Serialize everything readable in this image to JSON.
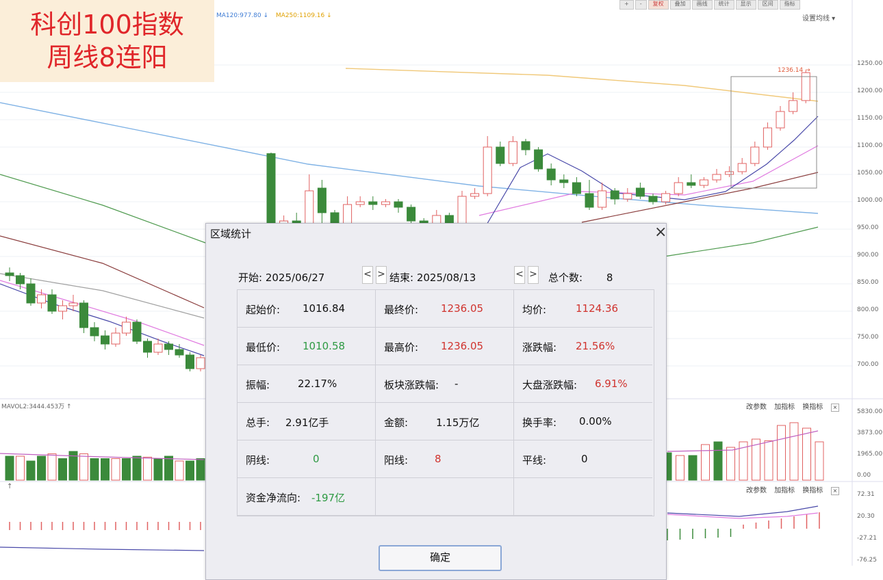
{
  "badge": {
    "line1": "科创100指数",
    "line2": "周线8连阳"
  },
  "toolbar": {
    "btn1": "+",
    "btn2": "-",
    "btn3": "复权",
    "btn4": "叠加",
    "btn5": "画线",
    "btn6": "统计",
    "btn7": "显示",
    "btn8": "区间",
    "btn9": "指标"
  },
  "ma_legend": {
    "ma120": "MA120:977.80 ↓",
    "ma250": "MA250:1109.16 ↓"
  },
  "settings_label": "设置均线 ▾",
  "price_axis": [
    "1250.00",
    "1200.00",
    "1150.00",
    "1100.00",
    "1050.00",
    "1000.00",
    "950.00",
    "900.00",
    "850.00",
    "800.00",
    "750.00",
    "700.00"
  ],
  "peak_label": "1236.14 →",
  "volume_label": "MAVOL2:3444.453万 ↑",
  "volume_axis": [
    "5830.00",
    "3873.00",
    "1965.00",
    "0.00"
  ],
  "macd_axis": [
    "72.31",
    "20.30",
    "-27.21",
    "-76.25"
  ],
  "indicator_buttons": {
    "change": "改参数",
    "add": "加指标",
    "switch": "换指标",
    "close": "×"
  },
  "second_arrow": "↑",
  "dialog": {
    "title": "区域统计",
    "close": "×",
    "start_label": "开始:",
    "start_value": "2025/06/27",
    "end_label": "结束:",
    "end_value": "2025/08/13",
    "count_label": "总个数:",
    "count_value": "8",
    "prev": "<",
    "next": ">",
    "cells": [
      {
        "label": "起始价:",
        "value": "1016.84",
        "color": "black"
      },
      {
        "label": "最终价:",
        "value": "1236.05",
        "color": "red"
      },
      {
        "label": "均价:",
        "value": "1124.36",
        "color": "red"
      },
      {
        "label": "最低价:",
        "value": "1010.58",
        "color": "green"
      },
      {
        "label": "最高价:",
        "value": "1236.05",
        "color": "red"
      },
      {
        "label": "涨跌幅:",
        "value": "21.56%",
        "color": "red"
      },
      {
        "label": "振幅:",
        "value": "22.17%",
        "color": "black"
      },
      {
        "label": "板块涨跌幅:",
        "value": "-",
        "color": "black"
      },
      {
        "label": "大盘涨跌幅:",
        "value": "6.91%",
        "color": "red"
      },
      {
        "label": "总手:",
        "value": "2.91亿手",
        "color": "black"
      },
      {
        "label": "金额:",
        "value": "1.15万亿",
        "color": "black"
      },
      {
        "label": "换手率:",
        "value": "0.00%",
        "color": "black"
      },
      {
        "label": "阴线:",
        "value": "0",
        "color": "green"
      },
      {
        "label": "阳线:",
        "value": "8",
        "color": "red"
      },
      {
        "label": "平线:",
        "value": "0",
        "color": "black"
      },
      {
        "label": "资金净流向:",
        "value": "-197亿",
        "color": "green"
      },
      {
        "label": "",
        "value": "",
        "color": "black"
      },
      {
        "label": "",
        "value": "",
        "color": "black"
      }
    ],
    "ok_label": "确定"
  },
  "chart_data": {
    "type": "candlestick",
    "ylim": [
      680,
      1270
    ],
    "up_color": "#e06060",
    "down_color": "#3b8a3b",
    "candles": [
      [
        870,
        865,
        880,
        855
      ],
      [
        865,
        850,
        870,
        840
      ],
      [
        850,
        815,
        860,
        810
      ],
      [
        815,
        830,
        840,
        805
      ],
      [
        830,
        800,
        840,
        795
      ],
      [
        800,
        810,
        820,
        785
      ],
      [
        810,
        815,
        830,
        800
      ],
      [
        815,
        770,
        820,
        760
      ],
      [
        770,
        755,
        780,
        745
      ],
      [
        755,
        740,
        765,
        730
      ],
      [
        740,
        760,
        770,
        735
      ],
      [
        760,
        780,
        790,
        755
      ],
      [
        780,
        745,
        785,
        740
      ],
      [
        745,
        725,
        750,
        715
      ],
      [
        725,
        740,
        750,
        720
      ],
      [
        740,
        730,
        745,
        720
      ],
      [
        730,
        720,
        740,
        715
      ],
      [
        720,
        695,
        725,
        690
      ],
      [
        695,
        715,
        720,
        690
      ],
      [
        1088,
        950,
        1090,
        945
      ],
      [
        950,
        965,
        975,
        940
      ],
      [
        965,
        960,
        980,
        950
      ],
      [
        960,
        1020,
        1050,
        955
      ],
      [
        1025,
        980,
        1040,
        960
      ],
      [
        980,
        960,
        985,
        950
      ],
      [
        960,
        995,
        1010,
        955
      ],
      [
        995,
        1000,
        1010,
        990
      ],
      [
        1000,
        995,
        1010,
        985
      ],
      [
        995,
        1000,
        1005,
        990
      ],
      [
        1000,
        990,
        1005,
        980
      ],
      [
        990,
        965,
        995,
        955
      ],
      [
        965,
        955,
        970,
        945
      ],
      [
        955,
        975,
        985,
        950
      ],
      [
        975,
        960,
        980,
        950
      ],
      [
        960,
        1010,
        1020,
        955
      ],
      [
        1010,
        1015,
        1025,
        1005
      ],
      [
        1015,
        1100,
        1120,
        1010
      ],
      [
        1100,
        1070,
        1110,
        1065
      ],
      [
        1070,
        1110,
        1120,
        1065
      ],
      [
        1110,
        1095,
        1115,
        1085
      ],
      [
        1095,
        1060,
        1100,
        1055
      ],
      [
        1060,
        1040,
        1070,
        1030
      ],
      [
        1040,
        1035,
        1050,
        1025
      ],
      [
        1035,
        1015,
        1045,
        1010
      ],
      [
        1015,
        990,
        1040,
        985
      ],
      [
        990,
        1020,
        1035,
        985
      ],
      [
        1020,
        1005,
        1025,
        995
      ],
      [
        1005,
        1015,
        1025,
        1000
      ],
      [
        1025,
        1010,
        1035,
        1005
      ],
      [
        1010,
        1000,
        1015,
        995
      ],
      [
        1000,
        1015,
        1020,
        995
      ],
      [
        1015,
        1035,
        1045,
        1010
      ],
      [
        1035,
        1030,
        1050,
        1025
      ],
      [
        1030,
        1040,
        1045,
        1025
      ],
      [
        1040,
        1050,
        1060,
        1035
      ],
      [
        1050,
        1055,
        1065,
        1045
      ],
      [
        1055,
        1070,
        1080,
        1050
      ],
      [
        1070,
        1100,
        1110,
        1065
      ],
      [
        1100,
        1135,
        1145,
        1095
      ],
      [
        1135,
        1165,
        1175,
        1130
      ],
      [
        1165,
        1185,
        1200,
        1160
      ],
      [
        1185,
        1236,
        1240,
        1180
      ]
    ]
  }
}
